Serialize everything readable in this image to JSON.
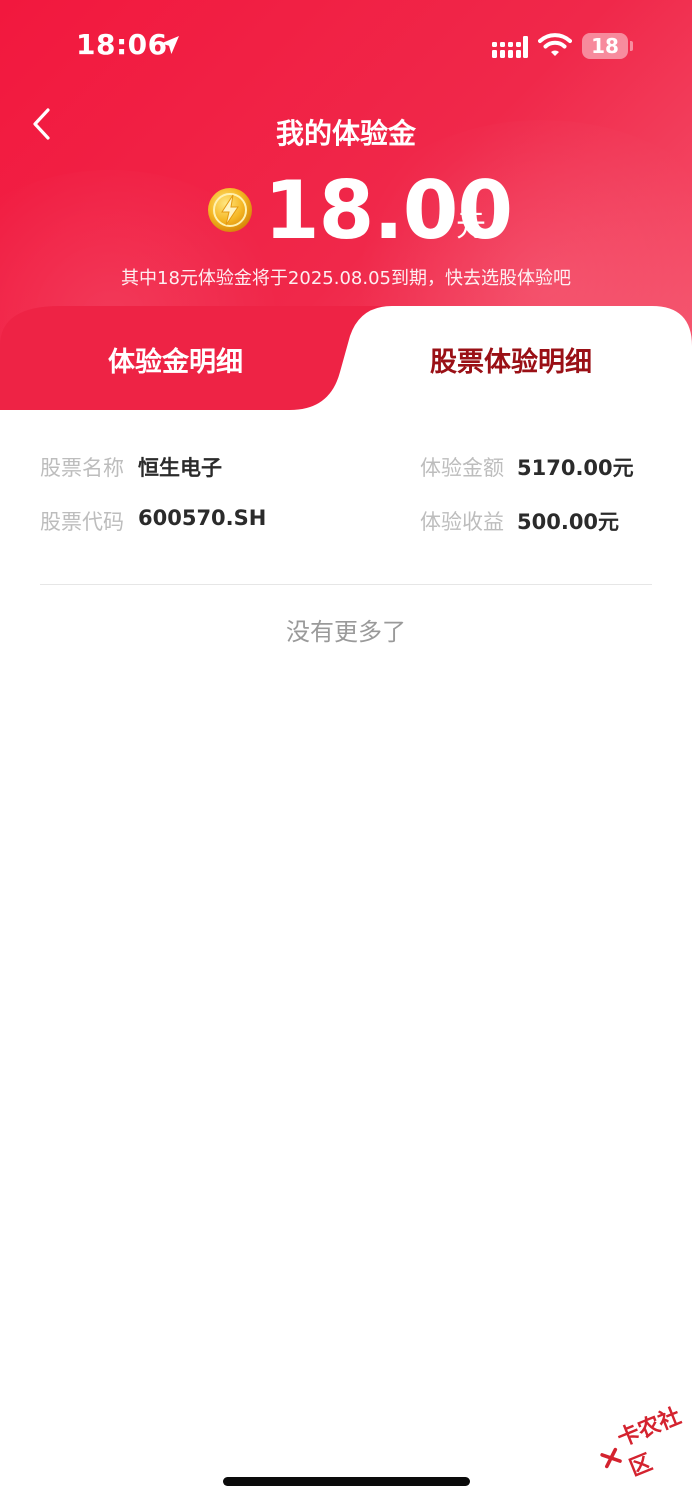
{
  "status_bar": {
    "time": "18:06",
    "battery": "18",
    "icons": [
      "location-arrow-icon",
      "signal-icon",
      "wifi-icon",
      "battery-icon"
    ]
  },
  "nav": {
    "back_icon": "chevron-left-icon",
    "title": "我的体验金"
  },
  "balance": {
    "coin_icon": "lightning-coin-icon",
    "amount": "18.00",
    "unit": "元",
    "note": "其中18元体验金将于2025.08.05到期，快去选股体验吧"
  },
  "tabs": [
    {
      "label": "体验金明细",
      "selected": false
    },
    {
      "label": "股票体验明细",
      "selected": true
    }
  ],
  "detail": {
    "stock_name_label": "股票名称",
    "stock_name_value": "恒生电子",
    "amount_label": "体验金额",
    "amount_value": "5170.00元",
    "stock_code_label": "股票代码",
    "stock_code_value": "600570.SH",
    "earnings_label": "体验收益",
    "earnings_value": "500.00元"
  },
  "footer_note": "没有更多了",
  "watermark": {
    "text": "卡农社区",
    "icon": "kanong-logo-icon"
  },
  "colors": {
    "header_red": "#f2183e",
    "tab_inactive_red": "#ee2345",
    "selected_tab_text": "#9a1016",
    "label_gray": "#bdbdbd",
    "value_dark": "#2b2b2b"
  }
}
